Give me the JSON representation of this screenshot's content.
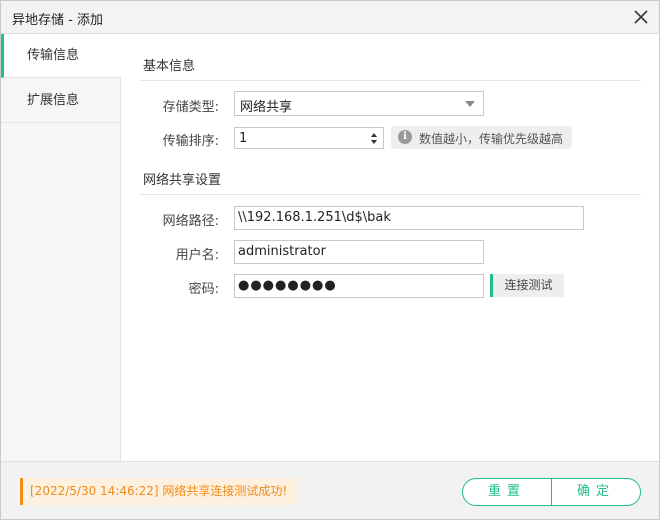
{
  "window": {
    "title": "异地存储 - 添加"
  },
  "sidebar": {
    "tabs": [
      {
        "label": "传输信息",
        "active": true
      },
      {
        "label": "扩展信息",
        "active": false
      }
    ]
  },
  "basic": {
    "section_title": "基本信息",
    "storage_type": {
      "label": "存储类型:",
      "value": "网络共享"
    },
    "transfer_order": {
      "label": "传输排序:",
      "value": "1"
    },
    "hint": "数值越小，传输优先级越高"
  },
  "share": {
    "section_title": "网络共享设置",
    "path": {
      "label": "网络路径:",
      "value": "\\\\192.168.1.251\\d$\\bak"
    },
    "username": {
      "label": "用户名:",
      "value": "administrator"
    },
    "password": {
      "label": "密码:",
      "value": "●●●●●●●●"
    },
    "test_button": "连接测试"
  },
  "footer": {
    "status": "[2022/5/30  14:46:22] 网络共享连接测试成功!",
    "reset_button": "重置",
    "ok_button": "确定"
  },
  "colors": {
    "accent": "#1fbf8a",
    "status": "#f08c1a"
  },
  "icons": {
    "close": "close-icon",
    "info": "info-icon",
    "dropdown": "chevron-down-icon"
  }
}
